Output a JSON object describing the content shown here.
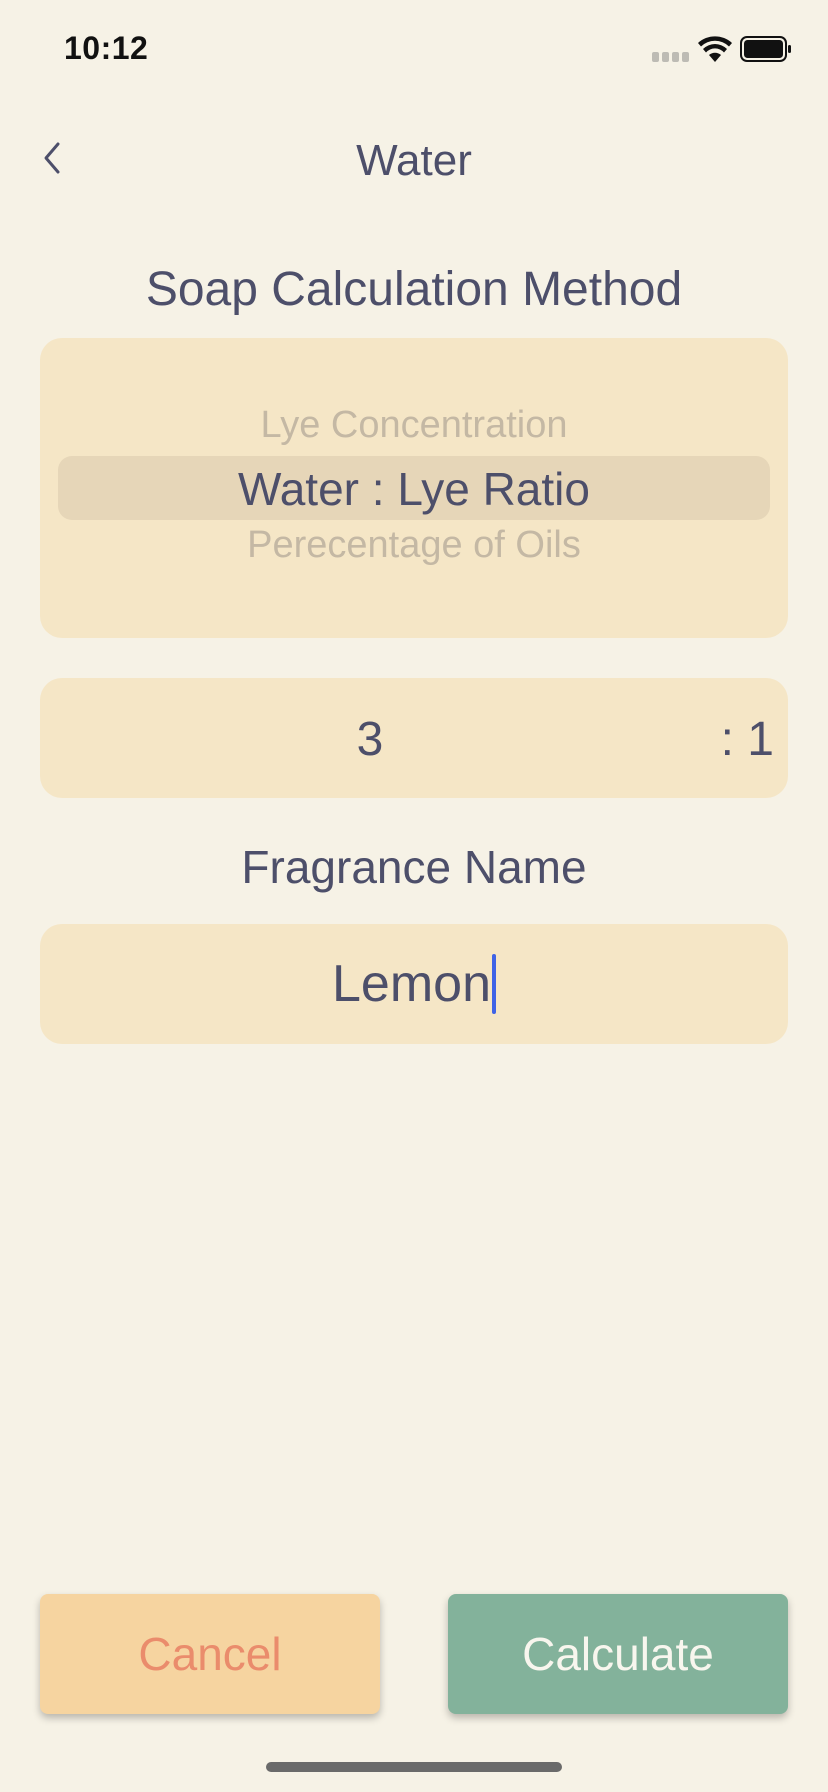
{
  "status_bar": {
    "time": "10:12"
  },
  "nav": {
    "title": "Water",
    "back_icon": "chevron-left-icon"
  },
  "method_section": {
    "heading": "Soap Calculation Method",
    "options": [
      "Lye Concentration",
      "Water : Lye Ratio",
      "Perecentage of Oils"
    ],
    "selected": "Water : Lye Ratio"
  },
  "ratio": {
    "value": "3",
    "suffix": ": 1"
  },
  "fragrance_section": {
    "heading": "Fragrance Name",
    "value": "Lemon"
  },
  "buttons": {
    "cancel": "Cancel",
    "calculate": "Calculate"
  },
  "colors": {
    "background": "#f6f2e6",
    "field": "#f5e6c6",
    "text": "#4d4f6a",
    "cancel_bg": "#f6d4a0",
    "cancel_text": "#ea8c6c",
    "calculate_bg": "#83b29b",
    "cursor": "#3f63e6"
  }
}
